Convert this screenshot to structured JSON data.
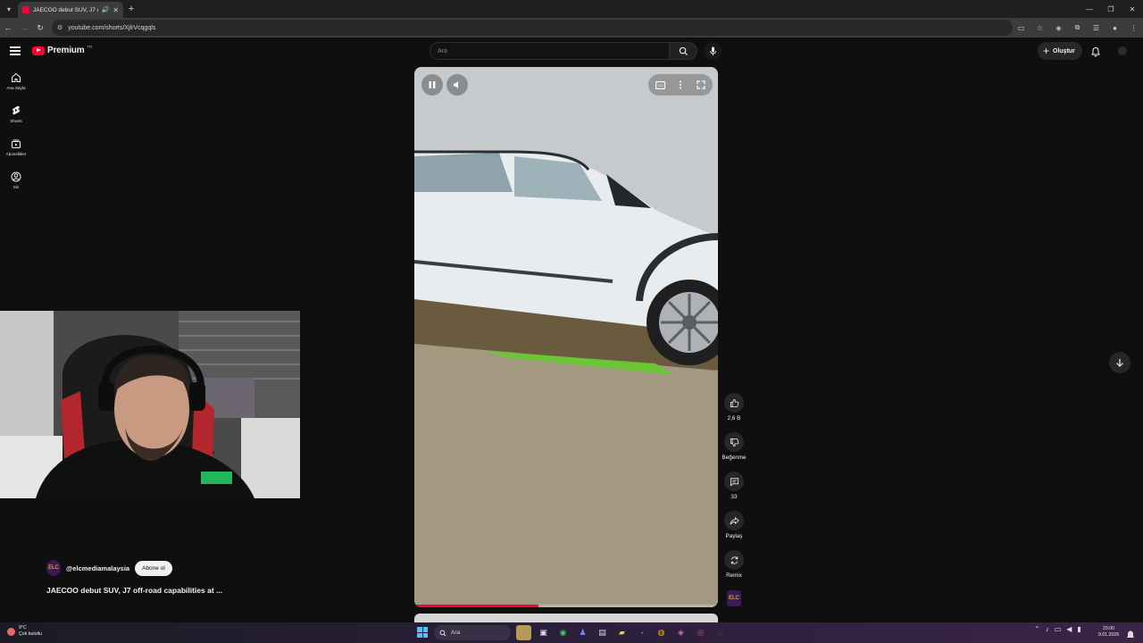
{
  "browser": {
    "tab_title": "JAECOO debut SUV, J7 off-",
    "url": "youtube.com/shorts/XjlrVcqgqls"
  },
  "header": {
    "brand": "Premium",
    "country": "TR",
    "search_placeholder": "Ara",
    "create_label": "Oluştur"
  },
  "sidebar": {
    "items": [
      {
        "label": "Ana Sayfa",
        "icon": "home-icon"
      },
      {
        "label": "Shorts",
        "icon": "shorts-icon"
      },
      {
        "label": "Abonelikler",
        "icon": "subscriptions-icon"
      },
      {
        "label": "Siz",
        "icon": "you-icon"
      }
    ]
  },
  "short": {
    "likes": "2,6 B",
    "dislike_label": "Beğenme",
    "comments": "33",
    "share_label": "Paylaş",
    "remix_label": "Remix",
    "progress": 0.41
  },
  "channel": {
    "handle": "@elcmediamalaysia",
    "subscribe_label": "Abone ol",
    "avatar_text": "ELC"
  },
  "video_title": "JAECOO debut SUV, J7 off-road capabilities at ...",
  "taskbar": {
    "temp": "9°C",
    "weather": "Çok bulutlu",
    "search_label": "Ara",
    "time": "23:00",
    "date": "9.01.2026"
  },
  "colors": {
    "brand_red": "#ff0033",
    "background": "#0f0f0f"
  }
}
